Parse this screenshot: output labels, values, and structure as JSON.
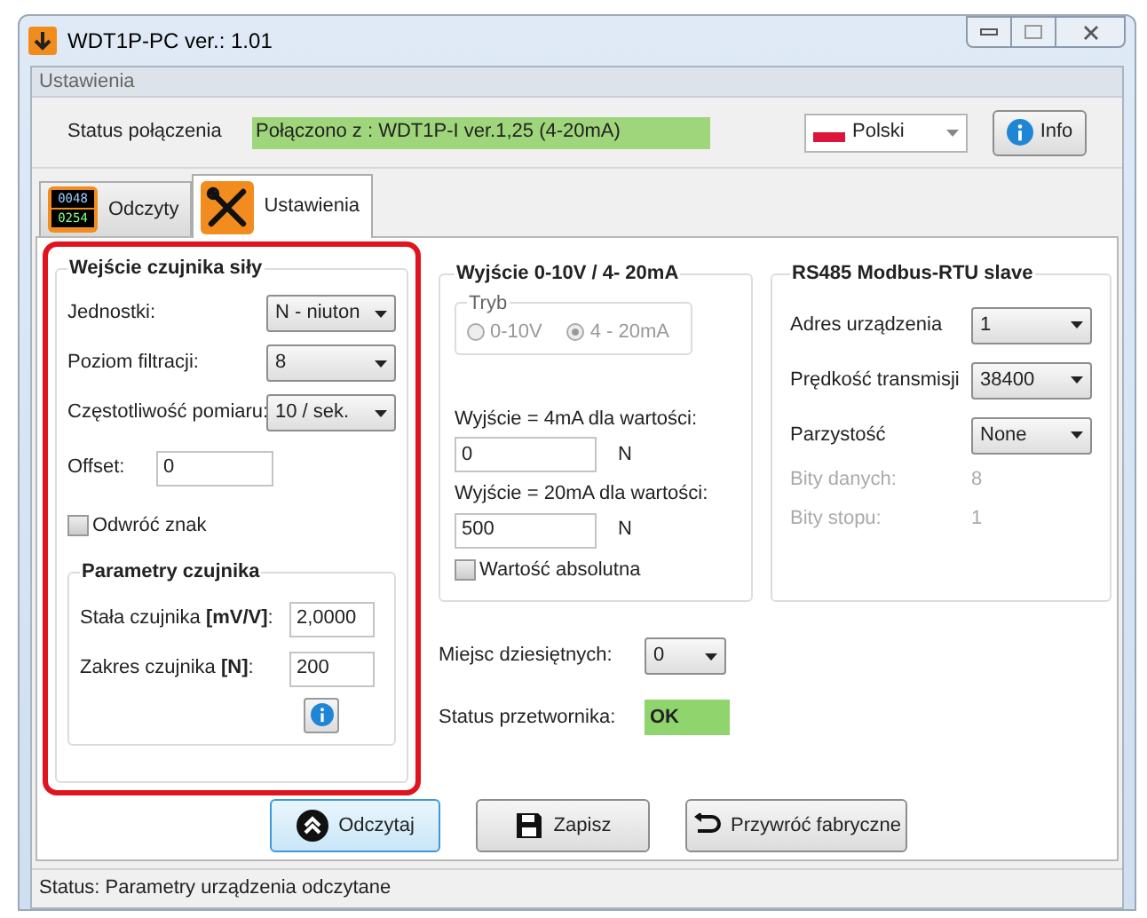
{
  "window": {
    "title": "WDT1P-PC  ver.: 1.01"
  },
  "menu_label": "Ustawienia",
  "connection": {
    "label": "Status połączenia",
    "value": "Połączono z : WDT1P-I ver.1,25 (4-20mA)"
  },
  "language": {
    "value": "Polski"
  },
  "info_button": {
    "label": "Info"
  },
  "tabs": [
    {
      "label": "Odczyty",
      "icon_lines": [
        "0048",
        "0254"
      ],
      "selected": false
    },
    {
      "label": "Ustawienia",
      "selected": true
    }
  ],
  "sensor_input": {
    "title": "Wejście czujnika siły",
    "highlighted": true,
    "fields": [
      {
        "kind": "select",
        "label": "Jednostki:",
        "value": "N - niuton"
      },
      {
        "kind": "select",
        "label": "Poziom filtracji:",
        "value": "8"
      },
      {
        "kind": "select",
        "label": "Częstotliwość pomiaru:",
        "value": "10 / sek."
      },
      {
        "kind": "input",
        "label": "Offset:",
        "value": "0"
      },
      {
        "kind": "checkbox",
        "label": "Odwróć znak",
        "checked": false
      }
    ],
    "params": {
      "title": "Parametry czujnika",
      "fields": [
        {
          "label": "Stała czujnika **[mV/V]**:",
          "value": "2,0000"
        },
        {
          "label": "Zakres czujnika **[N]**:",
          "value": "200"
        }
      ]
    }
  },
  "output": {
    "title": "Wyjście 0-10V / 4- 20mA",
    "mode": {
      "title": "Tryb",
      "disabled": true,
      "options": [
        {
          "label": "0-10V",
          "selected": false
        },
        {
          "label": "4 - 20mA",
          "selected": true
        }
      ]
    },
    "levels": [
      {
        "label": "Wyjście = 4mA dla wartości:",
        "value": "0",
        "unit": "N"
      },
      {
        "label": "Wyjście = 20mA dla wartości:",
        "value": "500",
        "unit": "N"
      }
    ],
    "absolute": {
      "label": "Wartość absolutna",
      "checked": false
    }
  },
  "modbus": {
    "title": "RS485 Modbus-RTU slave",
    "fields": [
      {
        "kind": "select",
        "label": "Adres urządzenia",
        "value": "1"
      },
      {
        "kind": "select",
        "label": "Prędkość transmisji",
        "value": "38400"
      },
      {
        "kind": "select",
        "label": "Parzystość",
        "value": "None"
      },
      {
        "kind": "readonly",
        "label": "Bity danych:",
        "value": "8"
      },
      {
        "kind": "readonly",
        "label": "Bity stopu:",
        "value": "1"
      }
    ]
  },
  "decimals": {
    "label": "Miejsc dziesiętnych:",
    "value": "0"
  },
  "transducer_status": {
    "label": "Status przetwornika:",
    "value": "OK"
  },
  "buttons": [
    {
      "label": "Odczytaj",
      "focused": true
    },
    {
      "label": "Zapisz",
      "focused": false
    },
    {
      "label": "Przywróć fabryczne",
      "focused": false
    }
  ],
  "status_bar": "Status:  Parametry urządzenia odczytane"
}
